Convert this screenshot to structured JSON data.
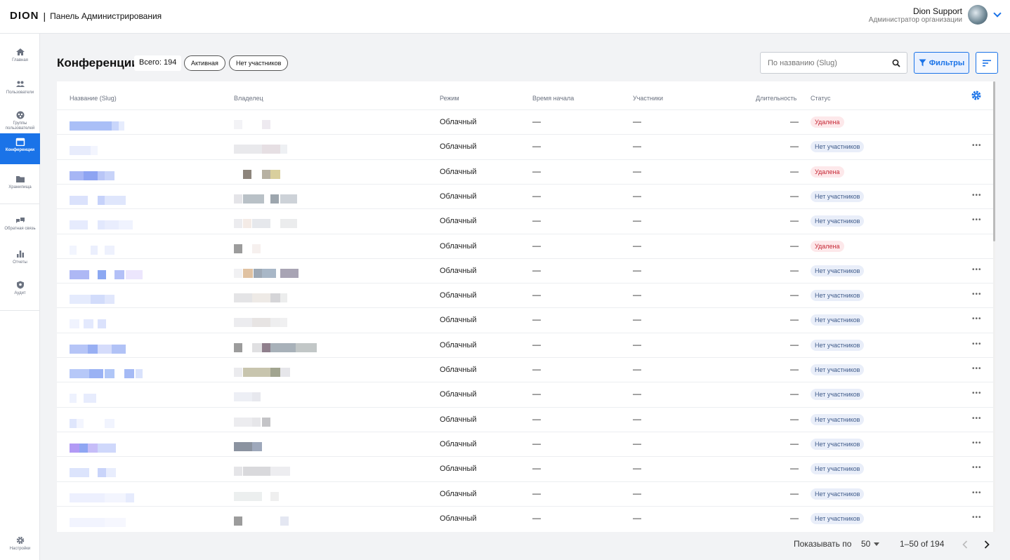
{
  "header": {
    "logo": "DION",
    "separator": "|",
    "title": "Панель Администрирования",
    "user_name": "Dion Support",
    "user_role": "Администратор организации"
  },
  "sidebar": {
    "items": [
      {
        "label": "Главная",
        "icon": "home-icon"
      },
      {
        "label": "Пользователи",
        "icon": "users-icon"
      },
      {
        "label": "Группы пользователей",
        "icon": "groups-icon"
      },
      {
        "label": "Конференции",
        "icon": "calendar-icon",
        "active": true
      },
      {
        "label": "Хранилища",
        "icon": "folder-icon"
      },
      {
        "label": "Обратная связь",
        "icon": "feedback-icon"
      },
      {
        "label": "Отчеты",
        "icon": "chart-icon"
      },
      {
        "label": "Аудит",
        "icon": "shield-icon"
      }
    ],
    "settings_label": "Настройки"
  },
  "toolbar": {
    "title": "Конференции",
    "total": "Всего: 194",
    "chip_active": "Активная",
    "chip_no_participants": "Нет участников",
    "search_placeholder": "По названию (Slug)",
    "filters_label": "Фильтры"
  },
  "table": {
    "columns": {
      "name": "Название (Slug)",
      "owner": "Владелец",
      "mode": "Режим",
      "start": "Время начала",
      "participants": "Участники",
      "duration": "Длительность",
      "status": "Статус"
    },
    "rows": [
      {
        "mode": "Облачный",
        "start": "—",
        "participants": "—",
        "duration": "—",
        "status": "Удалена",
        "status_color": "red",
        "menu": false
      },
      {
        "mode": "Облачный",
        "start": "—",
        "participants": "—",
        "duration": "—",
        "status": "Нет участников",
        "status_color": "blue",
        "menu": true
      },
      {
        "mode": "Облачный",
        "start": "—",
        "participants": "—",
        "duration": "—",
        "status": "Удалена",
        "status_color": "red",
        "menu": false
      },
      {
        "mode": "Облачный",
        "start": "—",
        "participants": "—",
        "duration": "—",
        "status": "Нет участников",
        "status_color": "blue",
        "menu": true
      },
      {
        "mode": "Облачный",
        "start": "—",
        "participants": "—",
        "duration": "—",
        "status": "Нет участников",
        "status_color": "blue",
        "menu": true
      },
      {
        "mode": "Облачный",
        "start": "—",
        "participants": "—",
        "duration": "—",
        "status": "Удалена",
        "status_color": "red",
        "menu": false
      },
      {
        "mode": "Облачный",
        "start": "—",
        "participants": "—",
        "duration": "—",
        "status": "Нет участников",
        "status_color": "blue",
        "menu": true
      },
      {
        "mode": "Облачный",
        "start": "—",
        "participants": "—",
        "duration": "—",
        "status": "Нет участников",
        "status_color": "blue",
        "menu": true
      },
      {
        "mode": "Облачный",
        "start": "—",
        "participants": "—",
        "duration": "—",
        "status": "Нет участников",
        "status_color": "blue",
        "menu": true
      },
      {
        "mode": "Облачный",
        "start": "—",
        "participants": "—",
        "duration": "—",
        "status": "Нет участников",
        "status_color": "blue",
        "menu": true
      },
      {
        "mode": "Облачный",
        "start": "—",
        "participants": "—",
        "duration": "—",
        "status": "Нет участников",
        "status_color": "blue",
        "menu": true
      },
      {
        "mode": "Облачный",
        "start": "—",
        "participants": "—",
        "duration": "—",
        "status": "Нет участников",
        "status_color": "blue",
        "menu": true
      },
      {
        "mode": "Облачный",
        "start": "—",
        "participants": "—",
        "duration": "—",
        "status": "Нет участников",
        "status_color": "blue",
        "menu": true
      },
      {
        "mode": "Облачный",
        "start": "—",
        "participants": "—",
        "duration": "—",
        "status": "Нет участников",
        "status_color": "blue",
        "menu": true
      },
      {
        "mode": "Облачный",
        "start": "—",
        "participants": "—",
        "duration": "—",
        "status": "Нет участников",
        "status_color": "blue",
        "menu": true
      },
      {
        "mode": "Облачный",
        "start": "—",
        "participants": "—",
        "duration": "—",
        "status": "Нет участников",
        "status_color": "blue",
        "menu": true
      },
      {
        "mode": "Облачный",
        "start": "—",
        "participants": "—",
        "duration": "—",
        "status": "Нет участников",
        "status_color": "blue",
        "menu": true
      }
    ]
  },
  "pagination": {
    "rows_label": "Показывать по",
    "rows_value": "50",
    "range": "1–50 of 194"
  },
  "colors": {
    "accent": "#1a73e8",
    "deleted_bg": "#fde8ea",
    "deleted_text": "#c62835",
    "no_participants_bg": "#e9eef9",
    "no_participants_text": "#3f5b8a"
  }
}
